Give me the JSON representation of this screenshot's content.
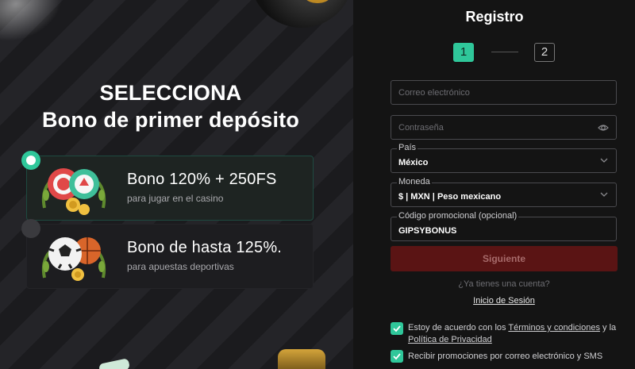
{
  "promo": {
    "title_line1": "SELECCIONA",
    "title_line2": "Bono de primer depósito",
    "bonuses": [
      {
        "title": "Bono 120% + 250FS",
        "subtitle": "para jugar en el casino",
        "selected": true
      },
      {
        "title": "Bono de hasta 125%.",
        "subtitle": "para apuestas deportivas",
        "selected": false
      }
    ]
  },
  "form": {
    "title": "Registro",
    "steps": [
      "1",
      "2"
    ],
    "active_step": 1,
    "email": {
      "placeholder": "Correo electrónico",
      "value": ""
    },
    "password": {
      "placeholder": "Contraseña",
      "value": ""
    },
    "country": {
      "label": "País",
      "value": "México"
    },
    "currency": {
      "label": "Moneda",
      "value": "$ | MXN | Peso mexicano"
    },
    "promo_code": {
      "label": "Código promocional (opcional)",
      "value": "GIPSYBONUS"
    },
    "next_button": "Siguiente",
    "have_account": "¿Ya tienes una cuenta?",
    "login_link": "Inicio de Sesión",
    "terms": {
      "prefix": "Estoy de acuerdo con los ",
      "terms_link": "Términos y condiciones",
      "middle": " y la ",
      "privacy_link": "Política de Privacidad",
      "checked": true
    },
    "promotions": {
      "text": "Recibir promociones por correo electrónico y SMS",
      "checked": true
    }
  },
  "colors": {
    "accent": "#2fc79a",
    "button_disabled": "#5a1414",
    "background": "#141414"
  },
  "icons": [
    "eye-icon",
    "chevron-down-icon",
    "check-icon",
    "casino-chips-icon",
    "sports-ball-icon"
  ]
}
